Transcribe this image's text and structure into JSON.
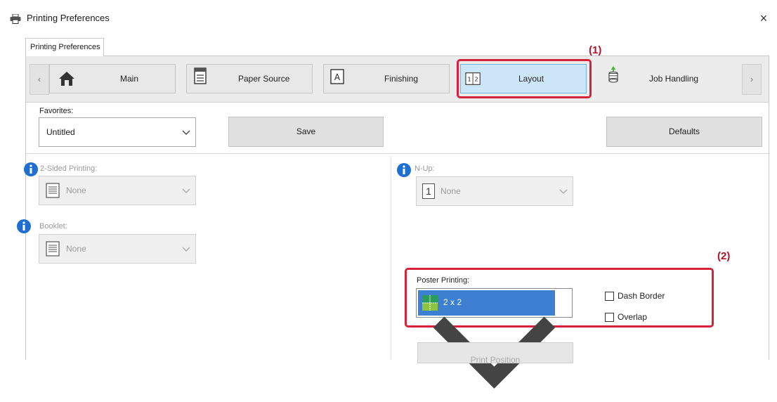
{
  "window": {
    "title": "Printing Preferences"
  },
  "outer_tab": {
    "label": "Printing Preferences"
  },
  "toolbar": {
    "prev": "‹",
    "next": "›",
    "tabs": [
      {
        "label": "Main",
        "icon": "home-icon"
      },
      {
        "label": "Paper Source",
        "icon": "paper-tray-icon"
      },
      {
        "label": "Finishing",
        "icon": "finishing-icon"
      },
      {
        "label": "Layout",
        "icon": "layout-icon",
        "active": true
      },
      {
        "label": "Job Handling",
        "icon": "job-handling-icon"
      }
    ]
  },
  "callouts": {
    "one": "(1)",
    "two": "(2)"
  },
  "favorites": {
    "label": "Favorites:",
    "value": "Untitled",
    "save": "Save",
    "defaults": "Defaults"
  },
  "two_sided": {
    "label": "2-Sided Printing:",
    "value": "None"
  },
  "booklet": {
    "label": "Booklet:",
    "value": "None"
  },
  "nup": {
    "label": "N-Up:",
    "value": "None",
    "badge": "1"
  },
  "poster": {
    "label": "Poster Printing:",
    "value": "2 x 2",
    "dash_border": "Dash Border",
    "overlap": "Overlap",
    "dash_border_checked": false,
    "overlap_checked": false
  },
  "print_position": {
    "label": "Print Position"
  },
  "colors": {
    "accent": "#3d7fd1",
    "active_tab": "#cde6f7",
    "callout": "#d6223b",
    "info": "#1f6fd1"
  }
}
